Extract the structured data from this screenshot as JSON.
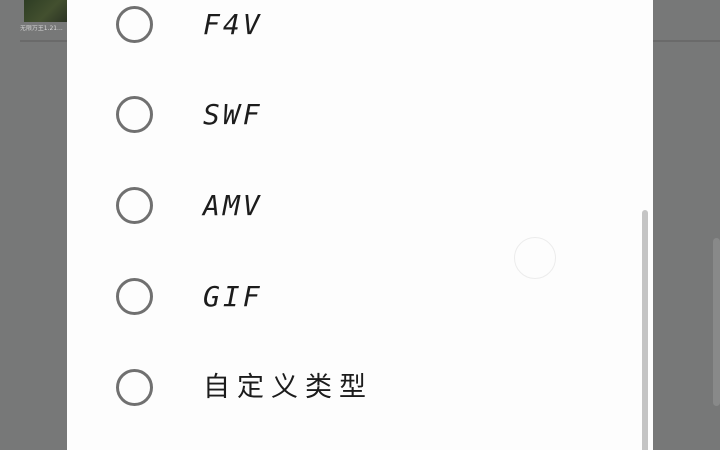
{
  "background": {
    "thumbnail_caption": "无限万王1.21..."
  },
  "dialog": {
    "options": [
      {
        "label": "F4V",
        "selected": false
      },
      {
        "label": "SWF",
        "selected": false
      },
      {
        "label": "AMV",
        "selected": false
      },
      {
        "label": "GIF",
        "selected": false
      },
      {
        "label": "自定义类型",
        "selected": false
      }
    ]
  }
}
